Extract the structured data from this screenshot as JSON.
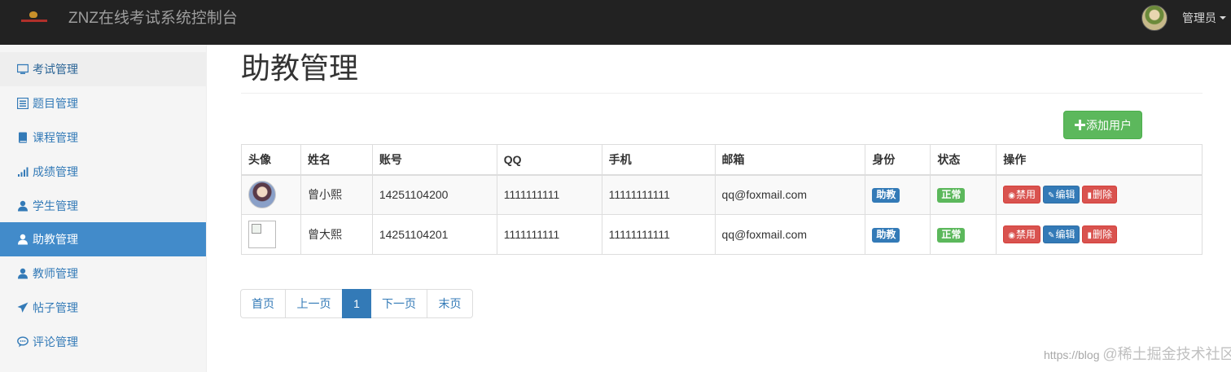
{
  "app": {
    "brand": "ZNZ在线考试系统控制台",
    "user_name": "管理员"
  },
  "sidebar": {
    "items": [
      {
        "label": "考试管理",
        "icon": "monitor-icon"
      },
      {
        "label": "题目管理",
        "icon": "list-alt-icon"
      },
      {
        "label": "课程管理",
        "icon": "book-icon"
      },
      {
        "label": "成绩管理",
        "icon": "signal-icon"
      },
      {
        "label": "学生管理",
        "icon": "user-icon"
      },
      {
        "label": "助教管理",
        "icon": "user-icon"
      },
      {
        "label": "教师管理",
        "icon": "user-icon"
      },
      {
        "label": "帖子管理",
        "icon": "send-icon"
      },
      {
        "label": "评论管理",
        "icon": "comment-icon"
      }
    ]
  },
  "main": {
    "title": "助教管理",
    "add_button": "添加用户"
  },
  "table": {
    "headers": [
      "头像",
      "姓名",
      "账号",
      "QQ",
      "手机",
      "邮箱",
      "身份",
      "状态",
      "操作"
    ],
    "rows": [
      {
        "name": "曾小熙",
        "account": "14251104200",
        "qq": "1111111111",
        "phone": "11111111111",
        "email": "qq@foxmail.com",
        "role": "助教",
        "status": "正常"
      },
      {
        "name": "曾大熙",
        "account": "14251104201",
        "qq": "1111111111",
        "phone": "11111111111",
        "email": "qq@foxmail.com",
        "role": "助教",
        "status": "正常"
      }
    ],
    "actions": {
      "disable": "禁用",
      "edit": "编辑",
      "delete": "删除"
    }
  },
  "pagination": {
    "first": "首页",
    "prev": "上一页",
    "current": "1",
    "next": "下一页",
    "last": "末页"
  },
  "watermark": {
    "url": "https://blog",
    "brand": "@稀土掘金技术社区"
  },
  "colors": {
    "navbar": "#222222",
    "active": "#428bca",
    "primary": "#337ab7",
    "success": "#5cb85c",
    "danger": "#d9534f"
  }
}
